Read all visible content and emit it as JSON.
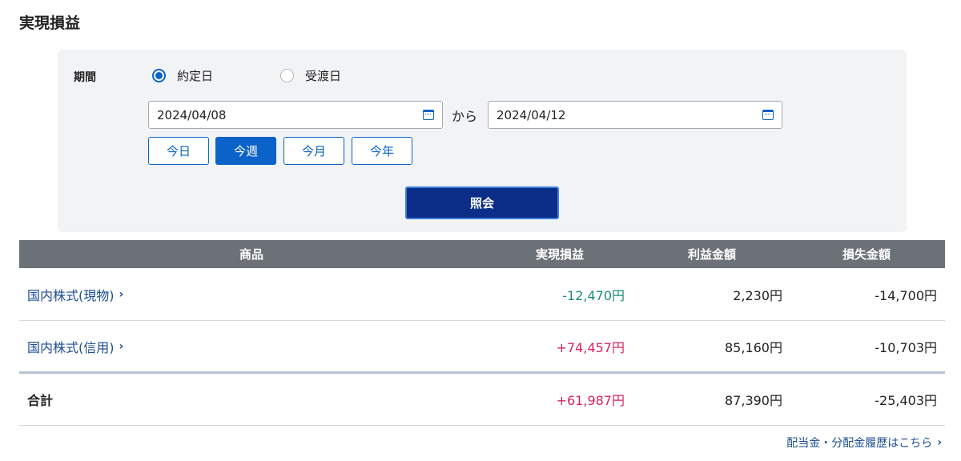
{
  "page": {
    "title": "実現損益"
  },
  "filter": {
    "period_label": "期間",
    "radio_contract": "約定日",
    "radio_delivery": "受渡日",
    "date_from": "2024/04/08",
    "separator": "から",
    "date_to": "2024/04/12",
    "quick": {
      "today": "今日",
      "week": "今週",
      "month": "今月",
      "year": "今年"
    },
    "query_label": "照会"
  },
  "table": {
    "headers": {
      "product": "商品",
      "realized": "実現損益",
      "profit": "利益金額",
      "loss": "損失金額"
    },
    "rows": [
      {
        "product": "国内株式(現物)",
        "realized": "-12,470円",
        "profit": "2,230円",
        "loss": "-14,700円"
      },
      {
        "product": "国内株式(信用)",
        "realized": "+74,457円",
        "profit": "85,160円",
        "loss": "-10,703円"
      }
    ],
    "total": {
      "label": "合計",
      "realized": "+61,987円",
      "profit": "87,390円",
      "loss": "-25,403円"
    }
  },
  "footer": {
    "dividend_link": "配当金・分配金履歴はこちら"
  },
  "colors": {
    "accent": "#0b62c8",
    "query_button": "#0b2d87",
    "negative": "#1b8a7a",
    "positive": "#d6245e",
    "header_bg": "#6c7178"
  }
}
